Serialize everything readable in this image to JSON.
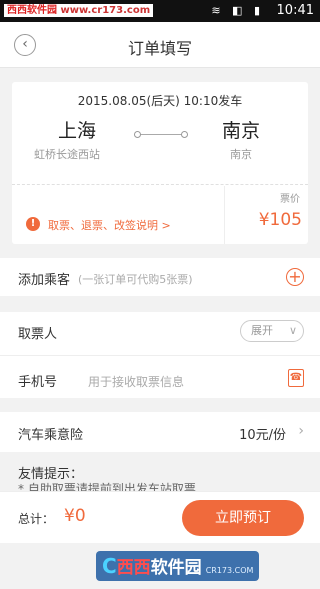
{
  "status_bar": {
    "watermark": "西西软件园",
    "url": "www.cr173.com",
    "icons": "wifi-icon signal-icon battery-icon",
    "time": "10:41"
  },
  "nav": {
    "title": "订单填写",
    "back_icon": "back-arrow-icon"
  },
  "trip": {
    "date_time": "2015.08.05(后天)  10:10发车",
    "from_city": "上海",
    "from_station": "虹桥长途西站",
    "to_city": "南京",
    "to_station": "南京",
    "help_text": "取票、退票、改签说明 >",
    "price_label": "票价",
    "price": "¥105"
  },
  "passenger": {
    "label": "添加乘客",
    "hint": "(一张订单可代购5张票)"
  },
  "ticket_collector": {
    "label": "取票人",
    "expand_label": "展开"
  },
  "phone": {
    "label": "手机号",
    "placeholder": "用于接收取票信息"
  },
  "insurance": {
    "label": "汽车乘意险",
    "value": "10元/份"
  },
  "tips": {
    "title": "友情提示：",
    "line1": "* 自助取票请提前到出发车站取票"
  },
  "bottom": {
    "total_label": "总计：",
    "total_value": "¥0",
    "book_button": "立即预订"
  },
  "footer_watermark": {
    "letter": "C",
    "name_red": "西西",
    "name": "软件园",
    "sub": "CR173.COM"
  },
  "colors": {
    "accent": "#f06a3c",
    "background": "#f2f2f2"
  }
}
